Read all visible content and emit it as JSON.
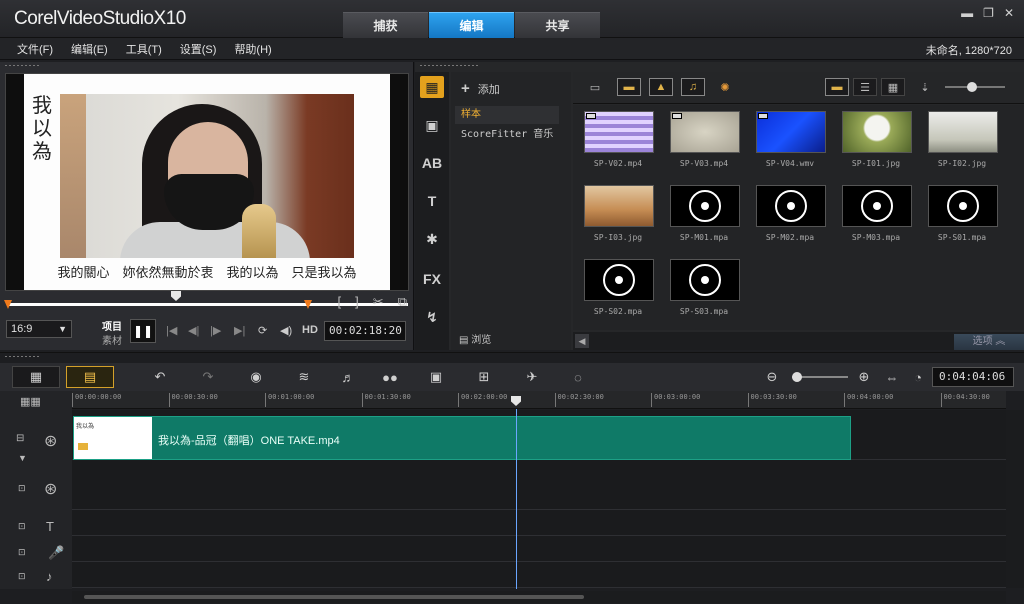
{
  "app": {
    "brand": "Corel",
    "product": "VideoStudio",
    "version": "X10"
  },
  "tabs": [
    {
      "label": "捕获",
      "active": false
    },
    {
      "label": "编辑",
      "active": true
    },
    {
      "label": "共享",
      "active": false
    }
  ],
  "window_controls": {
    "minimize": "▬",
    "restore": "❐",
    "close": "✕"
  },
  "menu": [
    "文件(F)",
    "编辑(E)",
    "工具(T)",
    "设置(S)",
    "帮助(H)"
  ],
  "project_info": "未命名, 1280*720",
  "player": {
    "video_title": "我以為",
    "subtitle": "我的關心　妳依然無動於衷　我的以為　只是我以為",
    "aspect_ratio": "16:9",
    "mode_project": "项目",
    "mode_clip": "素材",
    "play_icon": "❚❚",
    "timecode": "00:02:18:20",
    "hd_label": "HD",
    "scrub_progress": 0.42
  },
  "library": {
    "add_label": "添加",
    "folders": [
      {
        "label": "样本",
        "active": true
      },
      {
        "label": "ScoreFitter 音乐",
        "active": false
      }
    ],
    "browse_label": "浏览",
    "options_label": "选项",
    "side_tools": [
      "media-icon",
      "instant-project-icon",
      "transition-icon",
      "title-icon",
      "graphic-icon",
      "fx-icon",
      "path-icon"
    ],
    "side_labels": {
      "fx": "FX",
      "title": "T",
      "transition": "AB"
    },
    "items": [
      {
        "name": "SP-V02.mp4",
        "kind": "v02",
        "video": true
      },
      {
        "name": "SP-V03.mp4",
        "kind": "v03",
        "video": true
      },
      {
        "name": "SP-V04.wmv",
        "kind": "v04",
        "video": true
      },
      {
        "name": "SP-I01.jpg",
        "kind": "i01",
        "video": false
      },
      {
        "name": "SP-I02.jpg",
        "kind": "i02",
        "video": false
      },
      {
        "name": "SP-I03.jpg",
        "kind": "i03",
        "video": false
      },
      {
        "name": "SP-M01.mpa",
        "kind": "audio",
        "video": false
      },
      {
        "name": "SP-M02.mpa",
        "kind": "audio",
        "video": false
      },
      {
        "name": "SP-M03.mpa",
        "kind": "audio",
        "video": false
      },
      {
        "name": "SP-S01.mpa",
        "kind": "audio",
        "video": false
      },
      {
        "name": "SP-S02.mpa",
        "kind": "audio",
        "video": false
      },
      {
        "name": "SP-S03.mpa",
        "kind": "audio",
        "video": false
      }
    ]
  },
  "timeline": {
    "total_time": "0:04:04:06",
    "ruler": [
      "00:00:00:00",
      "00:00:30:00",
      "00:01:00:00",
      "00:01:30:00",
      "00:02:00:00",
      "00:02:30:00",
      "00:03:00:00",
      "00:03:30:00",
      "00:04:00:00",
      "00:04:30:00"
    ],
    "clip": {
      "name": "我以為-品冠（翻唱）ONE TAKE.mp4",
      "thumb_caption": "我以為"
    },
    "playhead_time": "00:02:18:20"
  }
}
